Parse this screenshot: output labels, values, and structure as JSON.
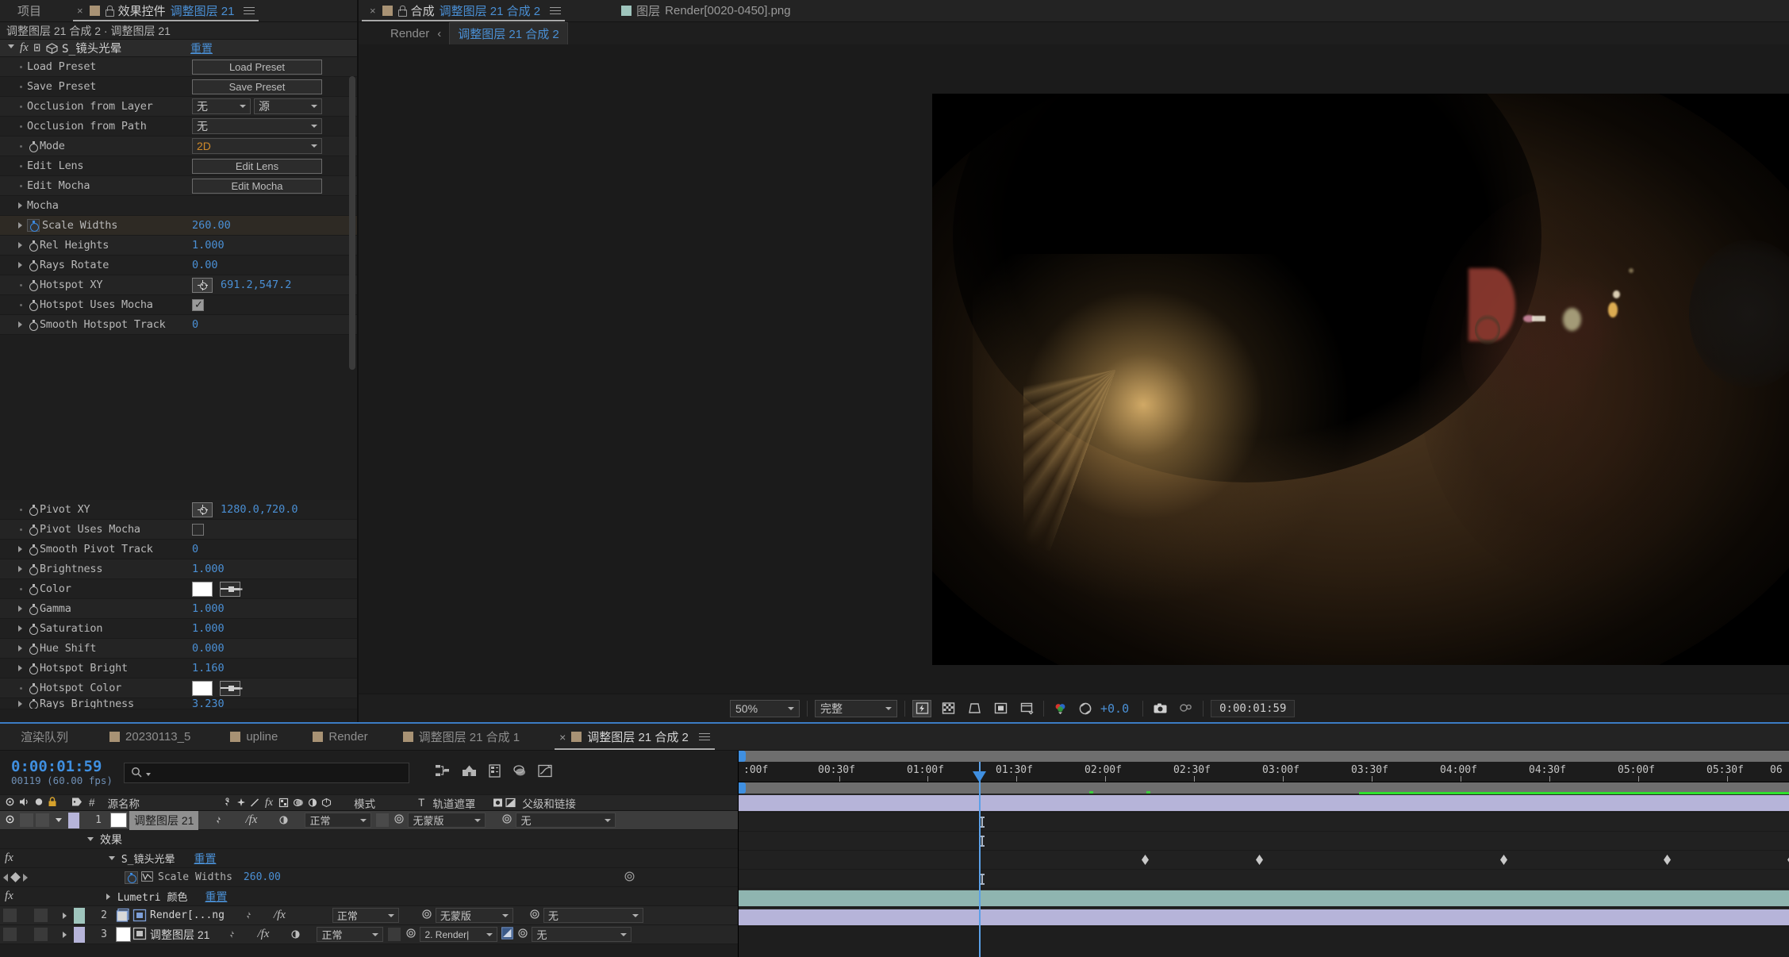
{
  "effect_controls": {
    "tabs": [
      {
        "label": "项目",
        "active": false,
        "icon": null
      },
      {
        "label_prefix": "效果控件",
        "label_blue": "调整图层 21",
        "active": true,
        "icon": "lock-icon"
      }
    ],
    "subheader": "调整图层 21 合成 2 · 调整图层 21",
    "effect_name": "S_镜头光晕",
    "reset_label": "重置",
    "params": [
      {
        "name": "Load Preset",
        "type": "button",
        "value": "Load Preset"
      },
      {
        "name": "Save Preset",
        "type": "button",
        "value": "Save Preset"
      },
      {
        "name": "Occlusion from Layer",
        "type": "dropdown2",
        "value": "无",
        "value2": "源"
      },
      {
        "name": "Occlusion from Path",
        "type": "dropdown",
        "value": "无"
      },
      {
        "name": "Mode",
        "type": "dropdown",
        "value": "2D",
        "stopwatch": true
      },
      {
        "name": "Edit Lens",
        "type": "button",
        "value": "Edit Lens"
      },
      {
        "name": "Edit Mocha",
        "type": "button",
        "value": "Edit Mocha"
      },
      {
        "name": "Mocha",
        "type": "group"
      },
      {
        "name": "Scale Widths",
        "type": "number",
        "value": "260.00",
        "expandable": true,
        "stopwatch": true,
        "selected": true
      },
      {
        "name": "Rel Heights",
        "type": "number",
        "value": "1.000",
        "expandable": true,
        "stopwatch": true
      },
      {
        "name": "Rays Rotate",
        "type": "number",
        "value": "0.00",
        "expandable": true,
        "stopwatch": true
      },
      {
        "name": "Hotspot XY",
        "type": "point",
        "value": "691.2,547.2",
        "stopwatch": true
      },
      {
        "name": "Hotspot Uses Mocha",
        "type": "checkbox",
        "value": "checked",
        "stopwatch": true
      },
      {
        "name": "Smooth Hotspot Track",
        "type": "number",
        "value": "0",
        "expandable": true,
        "stopwatch": true
      }
    ],
    "params_lower": [
      {
        "name": "Pivot XY",
        "type": "point",
        "value": "1280.0,720.0",
        "stopwatch": true
      },
      {
        "name": "Pivot Uses Mocha",
        "type": "checkbox",
        "value": "unchecked",
        "stopwatch": true
      },
      {
        "name": "Smooth Pivot Track",
        "type": "number",
        "value": "0",
        "expandable": true,
        "stopwatch": true
      },
      {
        "name": "Brightness",
        "type": "number",
        "value": "1.000",
        "expandable": true,
        "stopwatch": true
      },
      {
        "name": "Color",
        "type": "color",
        "value": "#ffffff",
        "stopwatch": true
      },
      {
        "name": "Gamma",
        "type": "number",
        "value": "1.000",
        "expandable": true,
        "stopwatch": true
      },
      {
        "name": "Saturation",
        "type": "number",
        "value": "1.000",
        "expandable": true,
        "stopwatch": true
      },
      {
        "name": "Hue Shift",
        "type": "number",
        "value": "0.000",
        "expandable": true,
        "stopwatch": true
      },
      {
        "name": "Hotspot Bright",
        "type": "number",
        "value": "1.160",
        "expandable": true,
        "stopwatch": true
      },
      {
        "name": "Hotspot Color",
        "type": "color",
        "value": "#ffffff",
        "stopwatch": true
      },
      {
        "name": "Rays Brightness",
        "type": "number",
        "value": "3.230",
        "expandable": true,
        "stopwatch": true
      }
    ]
  },
  "viewer": {
    "tabs": [
      {
        "close": "×",
        "swatch": "tan",
        "lock": true,
        "prefix": "合成",
        "blue": "调整图层 21 合成 2",
        "active": true
      },
      {
        "swatch": "teal",
        "prefix": "图层",
        "label": "Render[0020-0450].png",
        "active": false
      }
    ],
    "breadcrumb_root": "Render",
    "breadcrumb_sep": "‹",
    "breadcrumb_current": "调整图层 21 合成 2",
    "bottom_bar": {
      "zoom": "50%",
      "resolution": "完整",
      "exposure": "+0.0",
      "time": "0:00:01:59",
      "buttons": [
        "fast-preview-icon",
        "transparency-grid-icon",
        "region-of-interest-icon",
        "mask-guides-icon",
        "timeline-view-icon",
        "channel-icon",
        "exposure-icon",
        "snapshot-icon",
        "show-snapshot-icon"
      ]
    }
  },
  "timeline": {
    "tabs": [
      {
        "label": "渲染队列",
        "swatch": null,
        "active": false
      },
      {
        "label": "20230113_5",
        "swatch": "tan",
        "active": false
      },
      {
        "label": "upline",
        "swatch": "tan",
        "active": false
      },
      {
        "label": "Render",
        "swatch": "tan",
        "active": false
      },
      {
        "label": "调整图层 21 合成 1",
        "swatch": "tan",
        "active": false
      },
      {
        "label": "调整图层 21 合成 2",
        "swatch": "tan",
        "active": true,
        "close": "×"
      }
    ],
    "current_time": "0:00:01:59",
    "frame_info": "00119  (60.00 fps)",
    "search_placeholder": "",
    "columns": {
      "source_name": "源名称",
      "mode": "模式",
      "track_matte": "轨道遮罩",
      "parent_link": "父级和链接",
      "t_label": "T"
    },
    "layers": [
      {
        "index": "1",
        "name": "调整图层 21",
        "color": "#b6b4d9",
        "selected": true,
        "mode": "正常",
        "matte": "无蒙版",
        "parent": "无",
        "bar_color": "purple",
        "children": [
          {
            "label": "效果",
            "type": "group"
          },
          {
            "label": "S_镜头光晕",
            "type": "effect",
            "reset": "重置",
            "keyframes": false
          },
          {
            "label": "Scale Widths",
            "type": "property",
            "value": "260.00",
            "keyframe_times": [
              "02:00f",
              "02:15f",
              "02:30f",
              "03:15f",
              "04:20f",
              "05:28f"
            ]
          },
          {
            "label": "Lumetri 颜色",
            "type": "effect",
            "reset": "重置"
          }
        ]
      },
      {
        "index": "2",
        "name": "Render[...ng",
        "color": "#9fc5bd",
        "mode": "正常",
        "matte": "无蒙版",
        "parent": "无",
        "bar_color": "teal"
      },
      {
        "index": "3",
        "name": "调整图层 21",
        "color": "#b6b4d9",
        "mode": "正常",
        "matte": "2. Render|",
        "parent": "无",
        "bar_color": "purple"
      }
    ],
    "ruler_ticks": [
      ":00f",
      "00:30f",
      "01:00f",
      "01:30f",
      "02:00f",
      "02:30f",
      "03:00f",
      "03:30f",
      "04:00f",
      "04:30f",
      "05:00f",
      "05:30f",
      "06"
    ]
  },
  "colors": {
    "accent_blue": "#4a8fd4",
    "panel_bg": "#1e1e1e",
    "row_bg": "#242424",
    "selected_row": "#2e2a24",
    "layer_purple": "#b6b4d9",
    "layer_teal": "#9fc5bd",
    "tab_swatch_tan": "#a89274"
  }
}
